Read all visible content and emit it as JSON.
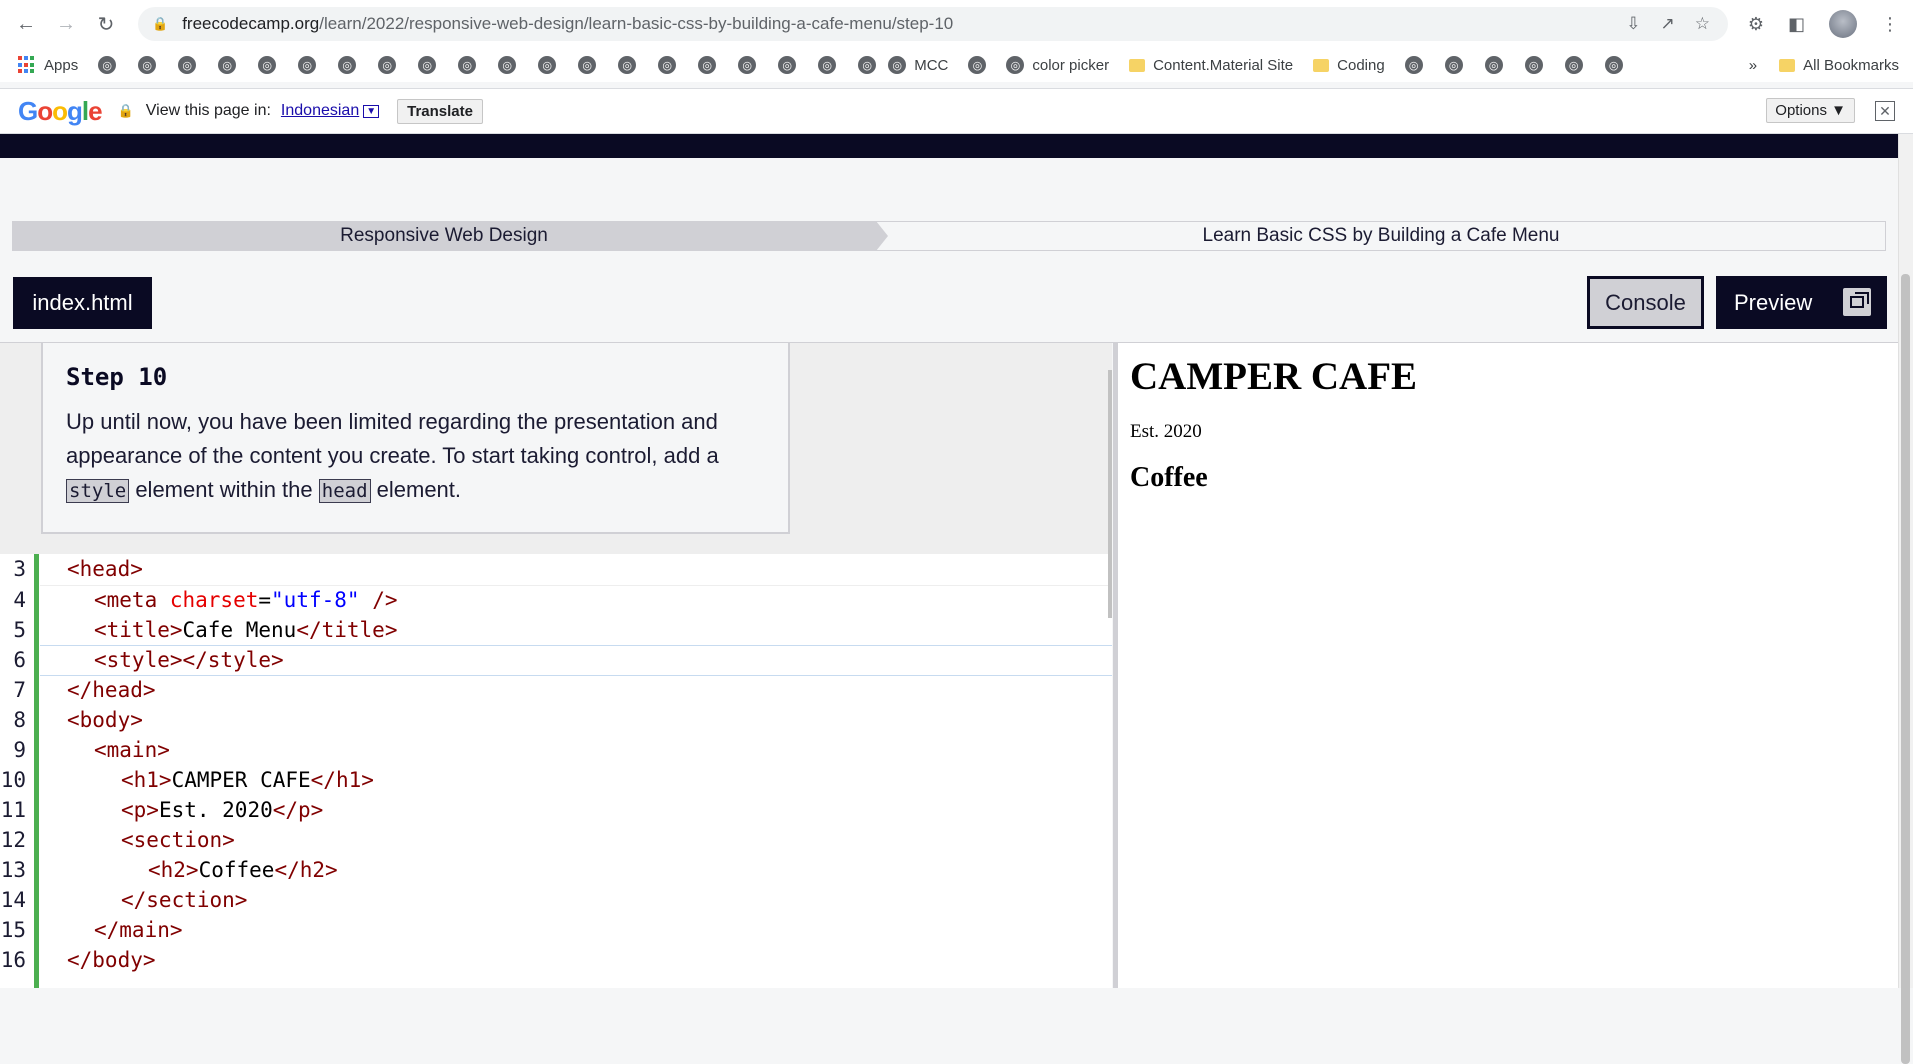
{
  "browser": {
    "url_host": "freecodecamp.org",
    "url_path": "/learn/2022/responsive-web-design/learn-basic-css-by-building-a-cafe-menu/step-10",
    "bookmarks": {
      "apps_label": "Apps",
      "mcc_label": "MCC",
      "color_picker_label": "color picker",
      "content_material_label": "Content.Material Site",
      "coding_label": "Coding",
      "overflow_label": "»",
      "all_bookmarks_label": "All Bookmarks"
    }
  },
  "translate_bar": {
    "logo_letters": [
      "G",
      "o",
      "o",
      "g",
      "l",
      "e"
    ],
    "prompt": "View this page in:",
    "language": "Indonesian",
    "translate_label": "Translate",
    "options_label": "Options ▼",
    "close_label": "✕"
  },
  "breadcrumb": {
    "superblock": "Responsive Web Design",
    "block": "Learn Basic CSS by Building a Cafe Menu"
  },
  "toolbar": {
    "file_tab": "index.html",
    "console_label": "Console",
    "preview_label": "Preview"
  },
  "step": {
    "title": "Step 10",
    "desc_part1": "Up until now, you have been limited regarding the presentation and appearance of the content you create. To start taking control, add a ",
    "code1": "style",
    "desc_part2": " element within the ",
    "code2": "head",
    "desc_part3": " element."
  },
  "editor": {
    "lines": [
      {
        "num": "3"
      },
      {
        "num": "4"
      },
      {
        "num": "5"
      },
      {
        "num": "6"
      },
      {
        "num": "7"
      },
      {
        "num": "8"
      },
      {
        "num": "9"
      },
      {
        "num": "10"
      },
      {
        "num": "11"
      },
      {
        "num": "12"
      },
      {
        "num": "13"
      },
      {
        "num": "14"
      },
      {
        "num": "15"
      },
      {
        "num": "16"
      }
    ],
    "code": {
      "l3": "<head>",
      "l4_open": "<meta ",
      "l4_attr": "charset",
      "l4_eq": "=",
      "l4_val": "\"utf-8\"",
      "l4_close": " />",
      "l5_open": "<title>",
      "l5_text": "Cafe Menu",
      "l5_close": "</title>",
      "l6": "<style></style>",
      "l7": "</head>",
      "l8": "<body>",
      "l9": "<main>",
      "l10_open": "<h1>",
      "l10_text": "CAMPER CAFE",
      "l10_close": "</h1>",
      "l11_open": "<p>",
      "l11_text": "Est. 2020",
      "l11_close": "</p>",
      "l12": "<section>",
      "l13_open": "<h2>",
      "l13_text": "Coffee",
      "l13_close": "</h2>",
      "l14": "</section>",
      "l15": "</main>",
      "l16": "</body>"
    }
  },
  "preview": {
    "h1": "CAMPER CAFE",
    "p": "Est. 2020",
    "h2": "Coffee"
  },
  "colors": {
    "fcc_dark": "#0a0a23",
    "fcc_gray": "#d0d0d5",
    "gutter_green": "#4caf50"
  }
}
